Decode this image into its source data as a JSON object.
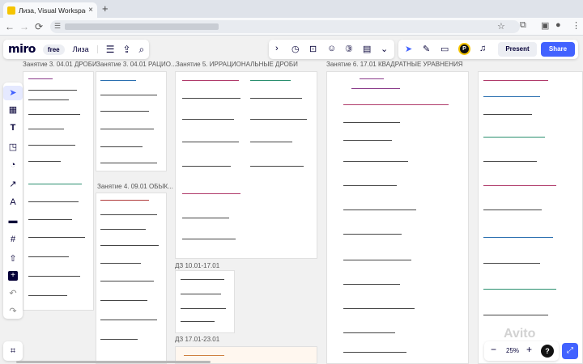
{
  "browser": {
    "tab_title": "Лиза, Visual Workspace for In",
    "tab_close": "×",
    "new_tab": "+",
    "back": "←",
    "forward": "→",
    "reload": "⟳"
  },
  "toolbar": {
    "logo": "miro",
    "plan": "free",
    "board_name": "Лиза",
    "present_label": "Present",
    "share_label": "Share",
    "avatar_initial": "P"
  },
  "frames": [
    {
      "label": "Занятие 3. 04.01 ДРОБИ"
    },
    {
      "label": "Занятие 3. 04.01 РАЦИО..."
    },
    {
      "label": "Занятие 4. 09.01 ОБЫК..."
    },
    {
      "label": "Занятие 5. ИРРАЦИОНАЛЬНЫЕ ДРОБИ"
    },
    {
      "label": "ДЗ 10.01-17.01"
    },
    {
      "label": "ДЗ 17.01-23.01"
    },
    {
      "label": "Занятие 6. 17.01 КВАДРАТНЫЕ УРАВНЕНИЯ"
    }
  ],
  "zoom": {
    "value": "25%",
    "minus": "−",
    "plus": "+"
  },
  "watermark": "Avito",
  "colors": {
    "accent": "#4262ff",
    "brand_yellow": "#f5c400",
    "ink_dark": "#050038"
  }
}
